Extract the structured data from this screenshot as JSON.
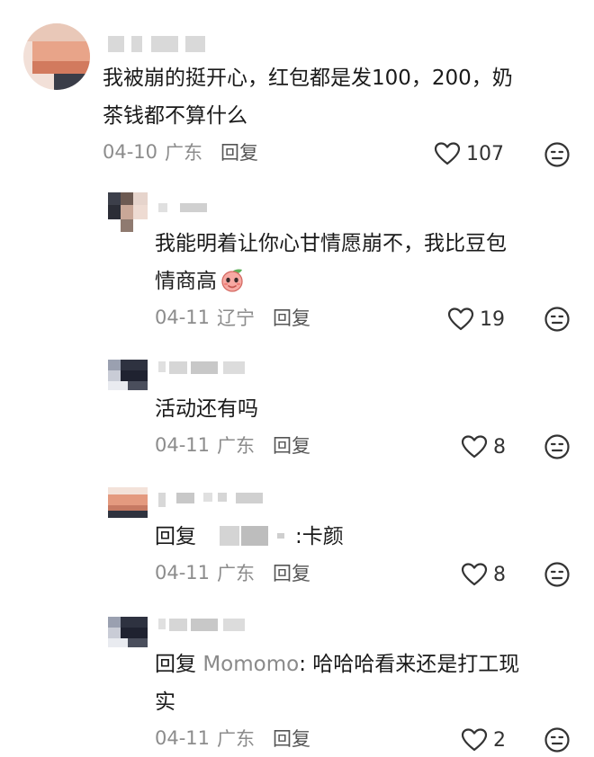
{
  "comments": [
    {
      "text": "我被崩的挺开心，红包都是发100，200，奶茶钱都不算什么",
      "line1": "我被崩的挺开心，红包都是发100，200，奶",
      "line2": "茶钱都不算什么",
      "date": "04-10",
      "location": "广东",
      "reply_label": "回复",
      "likes": "107"
    },
    {
      "line1": "我能明着让你心甘情愿崩不，我比豆包",
      "line2": "情商高",
      "date": "04-11",
      "location": "辽宁",
      "reply_label": "回复",
      "likes": "19"
    },
    {
      "line1": "活动还有吗",
      "date": "04-11",
      "location": "广东",
      "reply_label": "回复",
      "likes": "8"
    },
    {
      "reply_prefix": "回复",
      "reply_suffix": ":卡颜",
      "date": "04-11",
      "location": "广东",
      "reply_label": "回复",
      "likes": "8"
    },
    {
      "reply_prefix": "回复",
      "mention": "Momomo",
      "line1_rest": ": 哈哈哈看来还是打工现",
      "line2": "实",
      "date": "04-11",
      "location": "广东",
      "reply_label": "回复",
      "likes": "2"
    }
  ],
  "icons": {
    "like": "heart-outline-icon",
    "emoji": "neutral-face-icon",
    "inline_emoji": "peach-emoji"
  },
  "colors": {
    "text": "#1a1a1a",
    "meta": "#8c8c8c",
    "mention": "#8a8a8a"
  }
}
